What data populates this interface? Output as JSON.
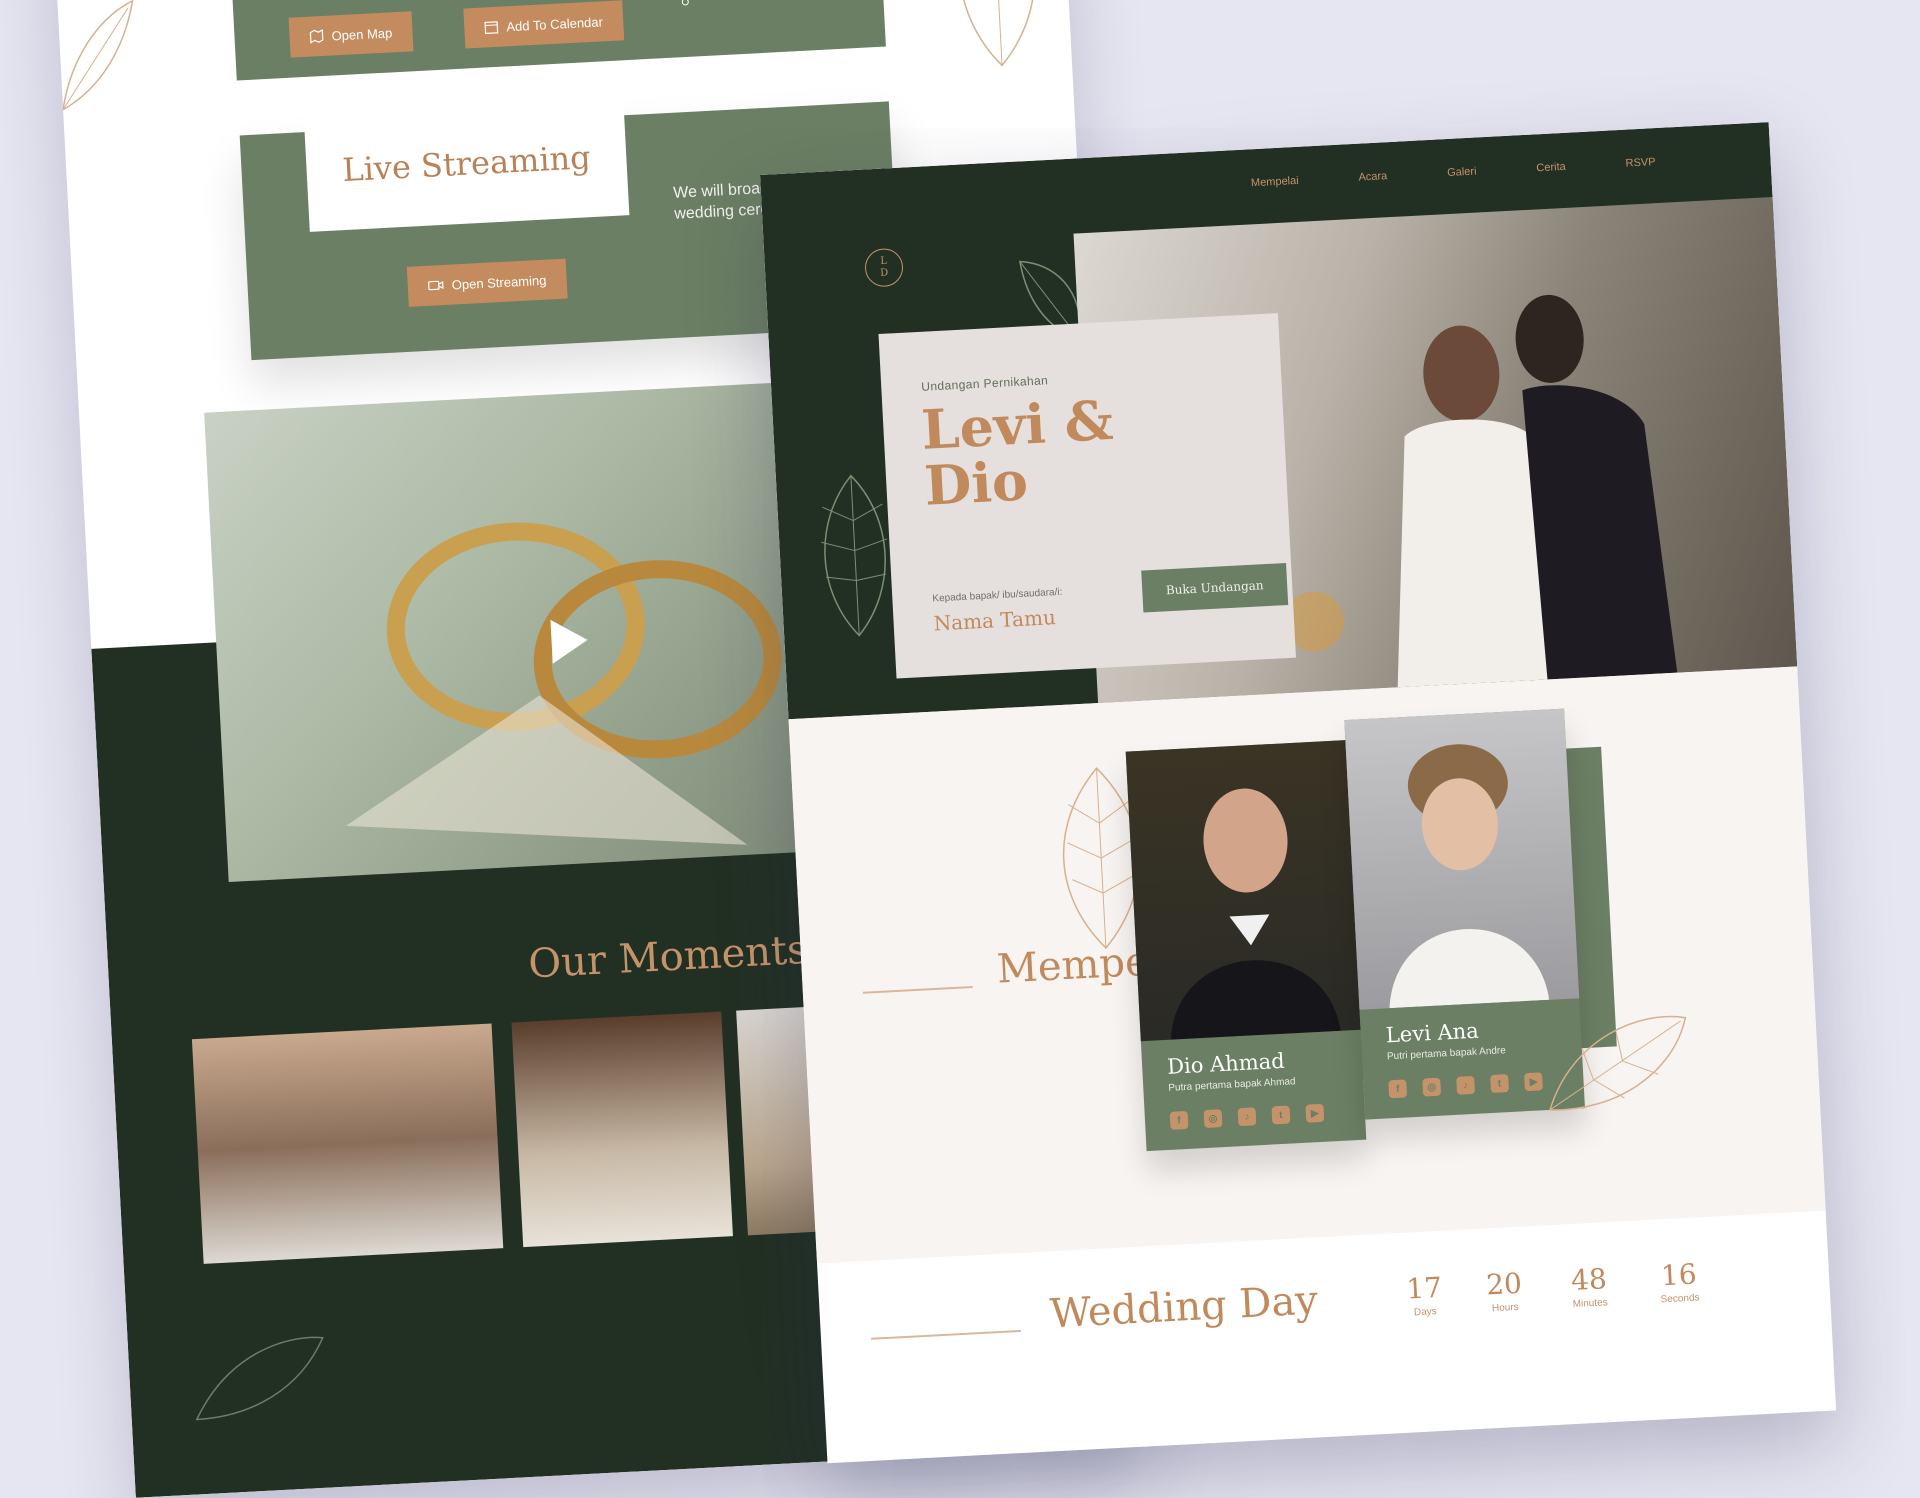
{
  "colors": {
    "background": "#e6e6f2",
    "dark_green": "#223024",
    "sage_green": "#6b7f64",
    "accent_gold": "#c08a5c",
    "orange_button": "#c48c5e",
    "cream": "#f8f4f1"
  },
  "back_page": {
    "event": {
      "map_button": "Open Map",
      "calendar_button": "Add To Calendar"
    },
    "live_streaming": {
      "title": "Live Streaming",
      "text": "We will broadcast the wedding ceremony virtually",
      "button": "Open Streaming"
    },
    "moments": {
      "title": "Our Moments"
    }
  },
  "front_page": {
    "nav": {
      "items": [
        "Mempelai",
        "Acara",
        "Galeri",
        "Cerita",
        "RSVP"
      ]
    },
    "monogram": {
      "top": "L",
      "bottom": "D"
    },
    "invite": {
      "label": "Undangan Pernikahan",
      "names_line1": "Levi &",
      "names_line2": "Dio",
      "to_label": "Kepada bapak/ ibu/saudara/i:",
      "guest_name": "Nama Tamu",
      "open_button": "Buka Undangan"
    },
    "couple": {
      "title": "Mempelai",
      "groom": {
        "name": "Dio Ahmad",
        "subtitle": "Putra pertama bapak Ahmad"
      },
      "bride": {
        "name": "Levi Ana",
        "subtitle": "Putri pertama bapak Andre"
      },
      "socials": [
        "facebook-icon",
        "instagram-icon",
        "tiktok-icon",
        "twitter-icon",
        "youtube-icon"
      ]
    },
    "countdown": {
      "title": "Wedding Day",
      "units": [
        {
          "value": "17",
          "label": "Days"
        },
        {
          "value": "20",
          "label": "Hours"
        },
        {
          "value": "48",
          "label": "Minutes"
        },
        {
          "value": "16",
          "label": "Seconds"
        }
      ]
    }
  }
}
